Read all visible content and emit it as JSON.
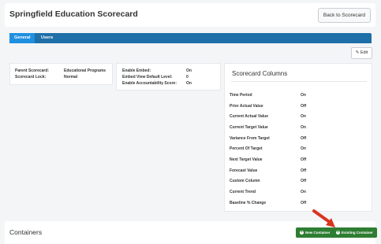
{
  "header": {
    "title": "Springfield Education Scorecard",
    "back_button": "Back to Scorecard"
  },
  "tabs": [
    {
      "label": "General",
      "active": true
    },
    {
      "label": "Users",
      "active": false
    }
  ],
  "edit_button": "Edit",
  "info": {
    "parent_label": "Parent Scorecard:",
    "parent_value": "Educational Programs",
    "lock_label": "Scorecard Lock:",
    "lock_value": "Normal"
  },
  "embed": {
    "enable_label": "Enable Embed:",
    "enable_value": "On",
    "view_label": "Embed View Default Level:",
    "view_value": "0",
    "acc_label": "Enable Accountability Score:",
    "acc_value": "On"
  },
  "columns": {
    "title": "Scorecard Columns",
    "rows": [
      {
        "label": "Time Period",
        "value": "On"
      },
      {
        "label": "Prior Actual Value",
        "value": "Off"
      },
      {
        "label": "Current Actual Value",
        "value": "On"
      },
      {
        "label": "Current Target Value",
        "value": "On"
      },
      {
        "label": "Variance From Target",
        "value": "Off"
      },
      {
        "label": "Percent Of Target",
        "value": "On"
      },
      {
        "label": "Next Target Value",
        "value": "Off"
      },
      {
        "label": "Forecast Value",
        "value": "Off"
      },
      {
        "label": "Custom Column",
        "value": "Off"
      },
      {
        "label": "Current Trend",
        "value": "On"
      },
      {
        "label": "Baseline % Change",
        "value": "Off"
      }
    ]
  },
  "footer": {
    "title": "Containers",
    "new_container": "New Container",
    "existing_container": "Existing Container"
  },
  "colors": {
    "tab_bar": "#1f6fa8",
    "tab_active": "#1f8fe0",
    "button_green": "#2e7d32",
    "annotation_arrow": "#d9341f"
  },
  "icons": {
    "edit": "edit-icon",
    "add": "plus-circle-icon"
  }
}
